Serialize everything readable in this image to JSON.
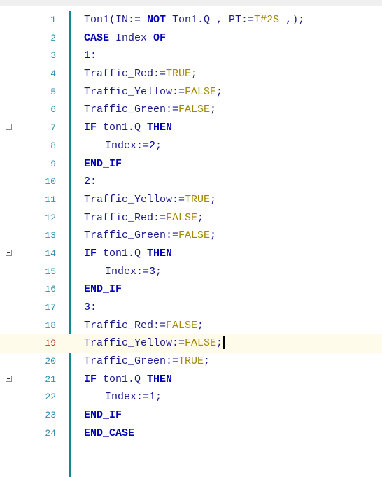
{
  "colors": {
    "gutter_bar": "#0f8a8a",
    "line_number": "#2b91af",
    "current_line_number": "#c0392b",
    "current_line_bg": "#fffbea",
    "keyword": "#0000b8",
    "literal": "#a08a00",
    "identifier": "#1a1a8c"
  },
  "icons": {
    "fold": "collapse-minus-icon"
  },
  "lines": [
    {
      "n": "1",
      "tokens": [
        {
          "t": "Ton1(IN:= ",
          "k": "plain"
        },
        {
          "t": "NOT",
          "k": "kw"
        },
        {
          "t": " Ton1.Q , PT:=",
          "k": "plain"
        },
        {
          "t": "T#2S",
          "k": "lit"
        },
        {
          "t": " ,);",
          "k": "plain"
        }
      ]
    },
    {
      "n": "2",
      "tokens": [
        {
          "t": "CASE",
          "k": "kw"
        },
        {
          "t": " Index ",
          "k": "plain"
        },
        {
          "t": "OF",
          "k": "kw"
        }
      ]
    },
    {
      "n": "3",
      "tokens": [
        {
          "t": "1",
          "k": "num"
        },
        {
          "t": ":",
          "k": "plain"
        }
      ]
    },
    {
      "n": "4",
      "tokens": [
        {
          "t": "Traffic_Red:=",
          "k": "plain"
        },
        {
          "t": "TRUE",
          "k": "lit"
        },
        {
          "t": ";",
          "k": "plain"
        }
      ]
    },
    {
      "n": "5",
      "tokens": [
        {
          "t": "Traffic_Yellow:=",
          "k": "plain"
        },
        {
          "t": "FALSE",
          "k": "lit"
        },
        {
          "t": ";",
          "k": "plain"
        }
      ]
    },
    {
      "n": "6",
      "tokens": [
        {
          "t": "Traffic_Green:=",
          "k": "plain"
        },
        {
          "t": "FALSE",
          "k": "lit"
        },
        {
          "t": ";",
          "k": "plain"
        }
      ]
    },
    {
      "n": "7",
      "fold": true,
      "tokens": [
        {
          "t": "IF",
          "k": "kw"
        },
        {
          "t": " ton1.Q ",
          "k": "plain"
        },
        {
          "t": "THEN",
          "k": "kw"
        }
      ]
    },
    {
      "n": "8",
      "indent": true,
      "tokens": [
        {
          "t": "Index:=",
          "k": "plain"
        },
        {
          "t": "2",
          "k": "num"
        },
        {
          "t": ";",
          "k": "plain"
        }
      ]
    },
    {
      "n": "9",
      "tokens": [
        {
          "t": "END_IF",
          "k": "kw"
        }
      ]
    },
    {
      "n": "10",
      "tokens": [
        {
          "t": "2",
          "k": "num"
        },
        {
          "t": ":",
          "k": "plain"
        }
      ]
    },
    {
      "n": "11",
      "tokens": [
        {
          "t": "Traffic_Yellow:=",
          "k": "plain"
        },
        {
          "t": "TRUE",
          "k": "lit"
        },
        {
          "t": ";",
          "k": "plain"
        }
      ]
    },
    {
      "n": "12",
      "tokens": [
        {
          "t": "Traffic_Red:=",
          "k": "plain"
        },
        {
          "t": "FALSE",
          "k": "lit"
        },
        {
          "t": ";",
          "k": "plain"
        }
      ]
    },
    {
      "n": "13",
      "tokens": [
        {
          "t": "Traffic_Green:=",
          "k": "plain"
        },
        {
          "t": "FALSE",
          "k": "lit"
        },
        {
          "t": ";",
          "k": "plain"
        }
      ]
    },
    {
      "n": "14",
      "fold": true,
      "tokens": [
        {
          "t": "IF",
          "k": "kw"
        },
        {
          "t": " ton1.Q ",
          "k": "plain"
        },
        {
          "t": "THEN",
          "k": "kw"
        }
      ]
    },
    {
      "n": "15",
      "indent": true,
      "tokens": [
        {
          "t": "Index:=",
          "k": "plain"
        },
        {
          "t": "3",
          "k": "num"
        },
        {
          "t": ";",
          "k": "plain"
        }
      ]
    },
    {
      "n": "16",
      "tokens": [
        {
          "t": "END_IF",
          "k": "kw"
        }
      ]
    },
    {
      "n": "17",
      "tokens": [
        {
          "t": "3",
          "k": "num"
        },
        {
          "t": ":",
          "k": "plain"
        }
      ]
    },
    {
      "n": "18",
      "tokens": [
        {
          "t": "Traffic_Red:=",
          "k": "plain"
        },
        {
          "t": "FALSE",
          "k": "lit"
        },
        {
          "t": ";",
          "k": "plain"
        }
      ]
    },
    {
      "n": "19",
      "current": true,
      "tokens": [
        {
          "t": "Traffic_Yellow:=",
          "k": "plain"
        },
        {
          "t": "FALSE",
          "k": "lit"
        },
        {
          "t": ";",
          "k": "plain"
        }
      ]
    },
    {
      "n": "20",
      "tokens": [
        {
          "t": "Traffic_Green:=",
          "k": "plain"
        },
        {
          "t": "TRUE",
          "k": "lit"
        },
        {
          "t": ";",
          "k": "plain"
        }
      ]
    },
    {
      "n": "21",
      "fold": true,
      "tokens": [
        {
          "t": "IF",
          "k": "kw"
        },
        {
          "t": " ton1.Q ",
          "k": "plain"
        },
        {
          "t": "THEN",
          "k": "kw"
        }
      ]
    },
    {
      "n": "22",
      "indent": true,
      "tokens": [
        {
          "t": "Index:=",
          "k": "plain"
        },
        {
          "t": "1",
          "k": "num"
        },
        {
          "t": ";",
          "k": "plain"
        }
      ]
    },
    {
      "n": "23",
      "tokens": [
        {
          "t": "END_IF",
          "k": "kw"
        }
      ]
    },
    {
      "n": "24",
      "tokens": [
        {
          "t": "END_CASE",
          "k": "kw"
        }
      ]
    }
  ]
}
